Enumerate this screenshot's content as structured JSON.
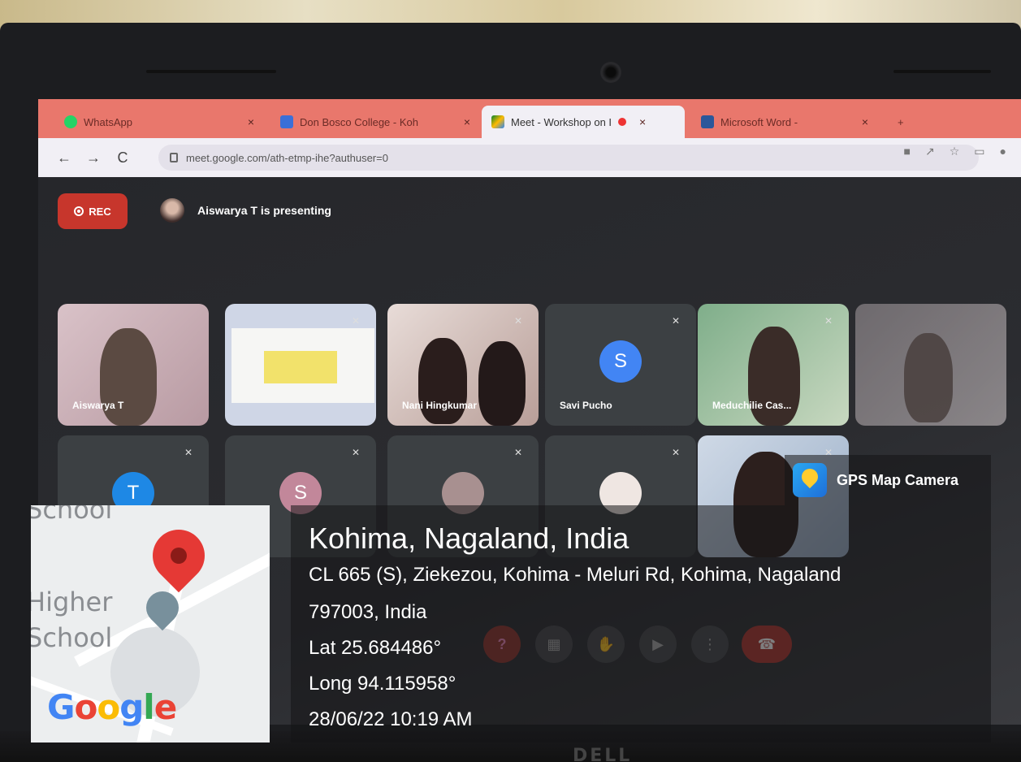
{
  "browser": {
    "tabs": [
      {
        "title": "WhatsApp",
        "close": "×"
      },
      {
        "title": "Don Bosco College - Koh",
        "close": "×"
      },
      {
        "title": "Meet - Workshop on I",
        "close": "×"
      },
      {
        "title": "Microsoft Word - ",
        "close": "×"
      }
    ],
    "new_tab": "+",
    "url": "meet.google.com/ath-etmp-ihe?authuser=0",
    "nav": {
      "back": "←",
      "forward": "→",
      "reload": "C"
    }
  },
  "meet": {
    "rec_label": "REC",
    "presenter_text": "Aiswarya T is presenting",
    "tiles": [
      {
        "name": "Aiswarya T",
        "avatar": ""
      },
      {
        "name": "",
        "avatar": ""
      },
      {
        "name": "Nani Hingkumar",
        "avatar": ""
      },
      {
        "name": "Savi Pucho",
        "avatar": "S"
      },
      {
        "name": "Meduchilie Cas...",
        "avatar": ""
      },
      {
        "name": "",
        "avatar": ""
      },
      {
        "name": "",
        "avatar": "T"
      },
      {
        "name": "",
        "avatar": "S"
      },
      {
        "name": "",
        "avatar": ""
      },
      {
        "name": "",
        "avatar": ""
      },
      {
        "name": "",
        "avatar": ""
      }
    ],
    "controls": [
      "?",
      "▦",
      "✋",
      "▶",
      "⋮",
      "☎"
    ]
  },
  "gps": {
    "app_name": "GPS Map Camera",
    "location_title": "Kohima, Nagaland, India",
    "address_line1": "CL 665 (S), Ziekezou, Kohima - Meluri Rd, Kohima, Nagaland",
    "address_line2": "797003, India",
    "lat": "Lat 25.684486°",
    "long": "Long 94.115958°",
    "datetime": "28/06/22 10:19 AM"
  },
  "map": {
    "label_school_top": "School",
    "label_higher": "Higher",
    "label_school": "School",
    "brand": "Google",
    "brand_colors": [
      "#4285F4",
      "#EA4335",
      "#FBBC05",
      "#4285F4",
      "#34A853",
      "#EA4335"
    ]
  },
  "device": {
    "logo": "DELL"
  }
}
